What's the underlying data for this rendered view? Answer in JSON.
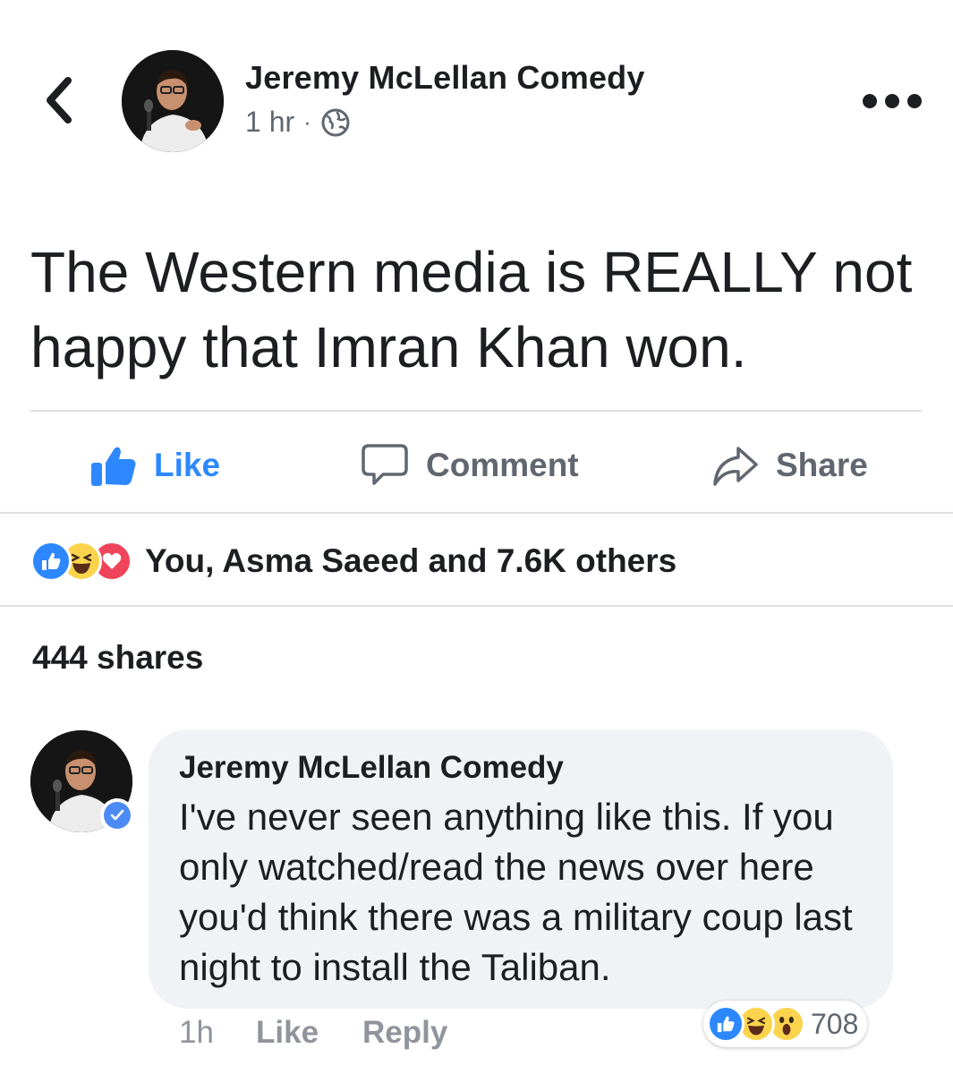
{
  "header": {
    "author": "Jeremy McLellan Comedy",
    "time": "1 hr",
    "separator": "·",
    "privacy_icon": "globe-icon",
    "back_icon": "chevron-left-icon",
    "more_icon": "more-dots-icon"
  },
  "post": {
    "text": "The Western media is REALLY not happy that Imran Khan won."
  },
  "actions": {
    "like_label": "Like",
    "comment_label": "Comment",
    "share_label": "Share"
  },
  "reactions": {
    "icons": [
      "like-reaction-icon",
      "haha-reaction-icon",
      "love-reaction-icon"
    ],
    "summary": "You, Asma Saeed and 7.6K others"
  },
  "shares": "444 shares",
  "comment": {
    "author": "Jeremy McLellan Comedy",
    "text": "I've never seen anything like this. If you only watched/read the news over here you'd think there was a military coup last night to install the Taliban.",
    "time": "1h",
    "like_label": "Like",
    "reply_label": "Reply",
    "reaction_icons": [
      "like-reaction-icon",
      "haha-reaction-icon",
      "wow-reaction-icon"
    ],
    "reaction_count": "708"
  },
  "colors": {
    "accent": "#2d88ff",
    "text": "#1c1e21",
    "muted": "#606770",
    "bubble": "#f0f2f5",
    "love": "#f0445a",
    "haha": "#fcd34d"
  }
}
